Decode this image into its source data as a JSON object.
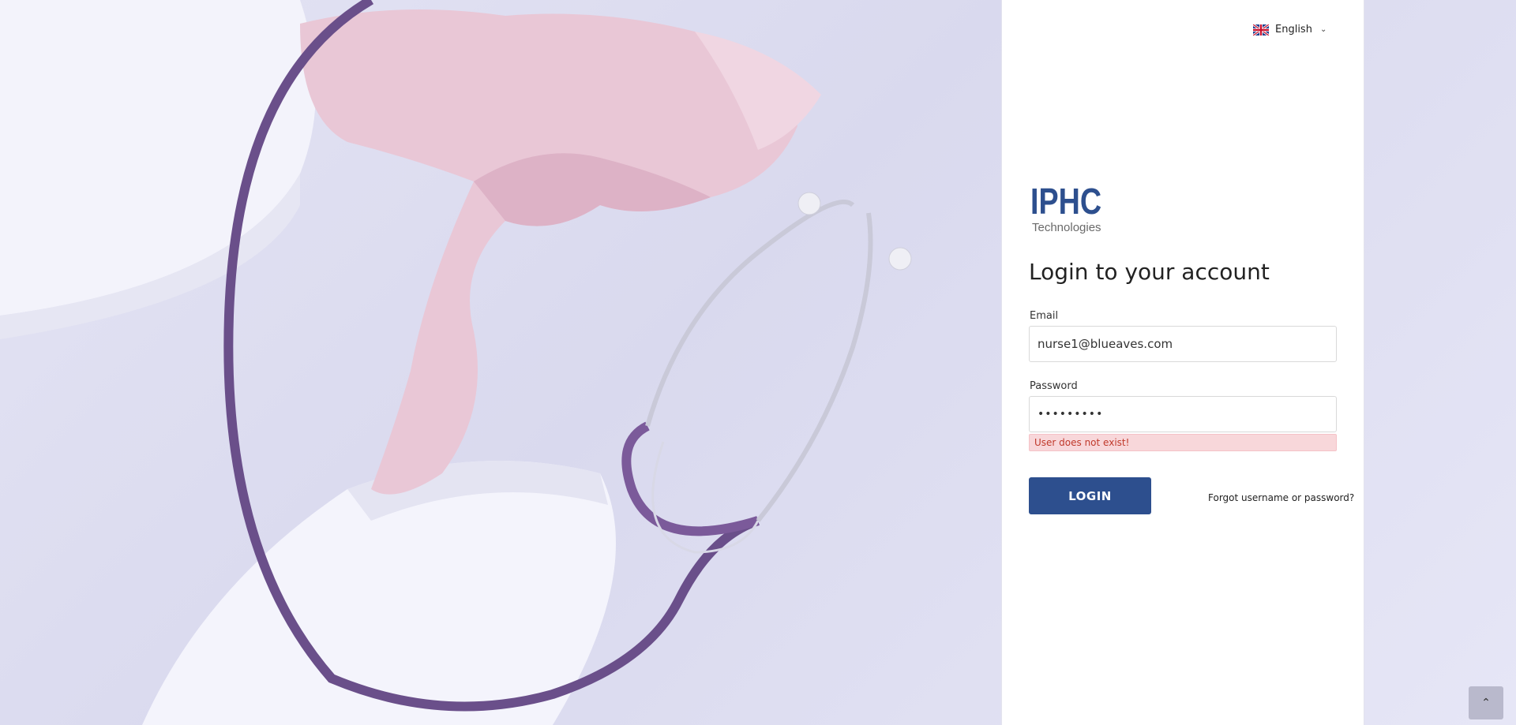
{
  "language": {
    "selected": "English",
    "flag_icon": "uk-flag-icon"
  },
  "logo": {
    "main": "IPHC",
    "sub": "Technologies",
    "color": "#2d4f8e"
  },
  "form": {
    "title": "Login to your account",
    "email_label": "Email",
    "email_value": "nurse1@blueaves.com",
    "password_label": "Password",
    "password_value": "•••••••••",
    "error_message": "User does not exist!",
    "login_label": "LOGIN",
    "forgot_label": "Forgot username or password?"
  },
  "scroll_top_icon": "chevron-up-icon",
  "colors": {
    "accent": "#2d4f8e",
    "error_bg": "#f8d7da",
    "error_text": "#c0392b"
  }
}
